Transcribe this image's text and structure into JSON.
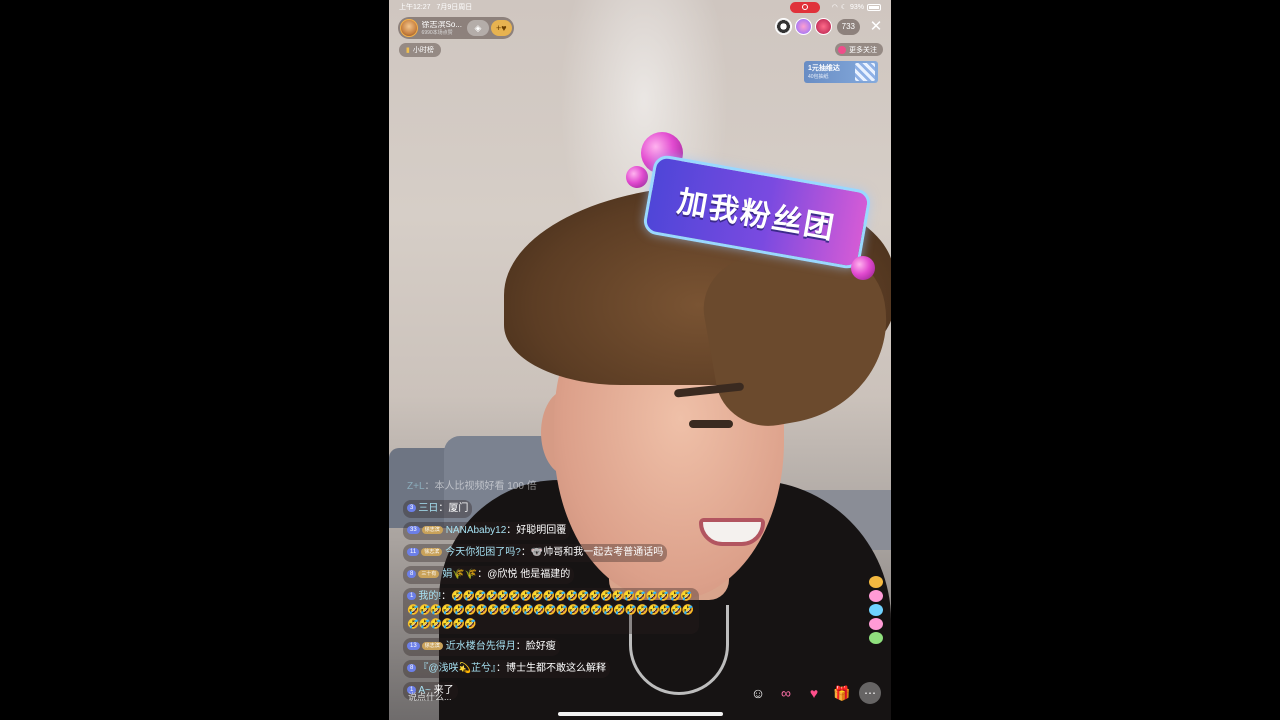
{
  "status_bar": {
    "time": "上午12:27",
    "date": "7月9日周日",
    "battery": "93%"
  },
  "host": {
    "name": "徐志滨So...",
    "subtitle": "6990本场点赞",
    "badge_icon": "diamond-icon",
    "follow_label": "+♥"
  },
  "hour_rank": {
    "label": "小时榜"
  },
  "viewers": {
    "count": "733",
    "close_icon": "close-icon"
  },
  "more_follow": {
    "label": "更多关注"
  },
  "lottery": {
    "title": "1元抽维达",
    "subtitle": "40包抽纸"
  },
  "fan_sticker": {
    "text": "加我粉丝团"
  },
  "chat": [
    {
      "level": "",
      "fan": "",
      "name": "Z+L",
      "sep": "：",
      "text": "本人比视频好看 100 倍",
      "fade": true
    },
    {
      "level": "3",
      "fan": "",
      "name": "三日",
      "sep": "：",
      "text": "厦门",
      "fade": false
    },
    {
      "level": "33",
      "fan": "徐志滨",
      "name": "NANAbaby12",
      "sep": "：",
      "text": "好聪明回覆",
      "fade": false
    },
    {
      "level": "11",
      "fan": "徐志滨",
      "name": "今天你犯困了吗?",
      "sep": "：",
      "text": "🐨帅哥和我一起去考普通话吗",
      "fade": false
    },
    {
      "level": "8",
      "fan": "三十有",
      "name": "娟🌾🌾",
      "sep": "：",
      "text": "@欣悦 他是福建的",
      "fade": false
    },
    {
      "level": "1",
      "fan": "",
      "name": "我的!",
      "sep": "：",
      "text": "🤣🤣🤣🤣🤣🤣🤣🤣🤣🤣🤣🤣🤣🤣🤣🤣🤣🤣🤣🤣🤣🤣🤣🤣🤣🤣🤣🤣🤣🤣🤣🤣🤣🤣🤣🤣🤣🤣🤣🤣🤣🤣🤣🤣🤣🤣🤣🤣🤣🤣🤣🤣",
      "fade": false
    },
    {
      "level": "13",
      "fan": "徐志滨",
      "name": "近水楼台先得月",
      "sep": "：",
      "text": "脸好瘦",
      "fade": false
    },
    {
      "level": "8",
      "fan": "",
      "name": "『@浅咲💫芷兮』",
      "sep": "：",
      "text": "博士生都不敢这么解释",
      "fade": false
    },
    {
      "level": "1",
      "fan": "",
      "name": "A~",
      "sep": " ",
      "text": "来了",
      "fade": false
    }
  ],
  "input": {
    "placeholder": "说点什么..."
  },
  "actions": [
    {
      "name": "emoji-button",
      "icon": "smile-icon",
      "glyph": "☺"
    },
    {
      "name": "link-button",
      "icon": "link-icon",
      "glyph": "∞"
    },
    {
      "name": "heart-button",
      "icon": "heart-icon",
      "glyph": "♥"
    },
    {
      "name": "gift-button",
      "icon": "gift-icon",
      "glyph": "🎁"
    },
    {
      "name": "more-button",
      "icon": "more-icon",
      "glyph": "⋯"
    }
  ],
  "colors": {
    "record": "#e0323a",
    "username": "#a6e1f2",
    "level_badge": "#6c7fe8",
    "fan_badge": "#c9a25a"
  }
}
